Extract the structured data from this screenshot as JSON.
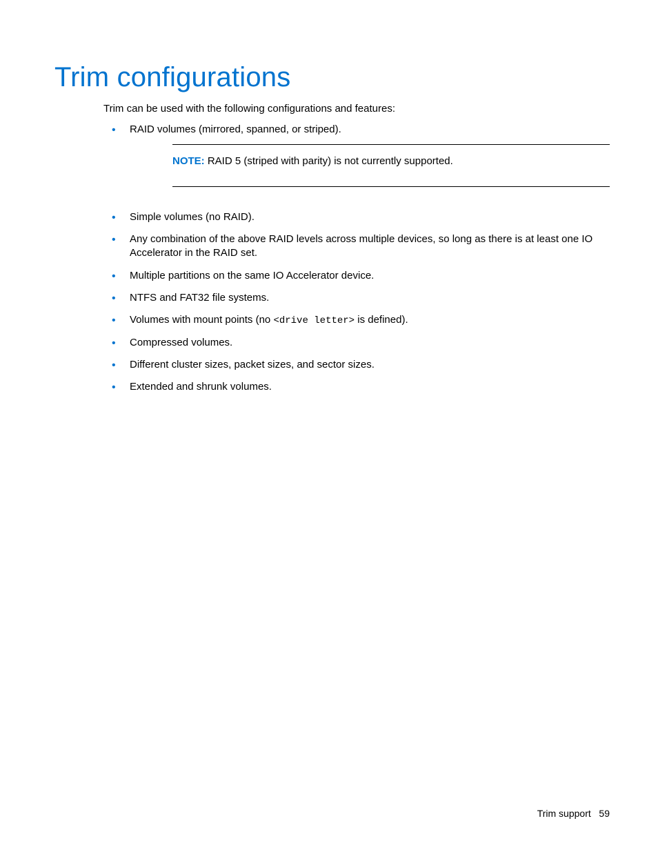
{
  "heading": "Trim configurations",
  "intro": "Trim can be used with the following configurations and features:",
  "items": {
    "i0": "RAID volumes (mirrored, spanned, or striped).",
    "i1": "Simple volumes (no RAID).",
    "i2": "Any combination of the above RAID levels across multiple devices, so long as there is at least one IO Accelerator in the RAID set.",
    "i3": "Multiple partitions on the same IO Accelerator device.",
    "i4": "NTFS and FAT32 file systems.",
    "i5_pre": "Volumes with mount points (no ",
    "i5_code": "<drive letter>",
    "i5_post": " is defined).",
    "i6": "Compressed volumes.",
    "i7": "Different cluster sizes, packet sizes, and sector sizes.",
    "i8": "Extended and shrunk volumes."
  },
  "note": {
    "label": "NOTE:",
    "text": "RAID 5 (striped with parity) is not currently supported."
  },
  "footer": {
    "section": "Trim support",
    "page": "59"
  }
}
